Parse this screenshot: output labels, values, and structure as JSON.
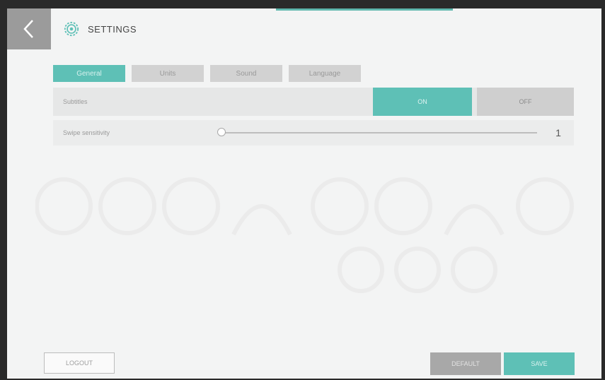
{
  "header": {
    "title": "SETTINGS",
    "back_icon": "chevron-left-icon",
    "settings_icon": "gear-icon"
  },
  "tabs": [
    {
      "label": "General",
      "active": true
    },
    {
      "label": "Units",
      "active": false
    },
    {
      "label": "Sound",
      "active": false
    },
    {
      "label": "Language",
      "active": false
    }
  ],
  "settings": {
    "subtitles": {
      "label": "Subtitles",
      "on_label": "ON",
      "off_label": "OFF",
      "value": "ON"
    },
    "swipe_sensitivity": {
      "label": "Swipe sensitivity",
      "value": "1",
      "level_fraction": 0.0
    }
  },
  "footer": {
    "logout_label": "LOGOUT",
    "default_label": "DEFAULT",
    "save_label": "SAVE"
  },
  "colors": {
    "accent": "#5ec0b6",
    "inactive": "#d2d2d2",
    "back_button": "#9b9b9b"
  }
}
